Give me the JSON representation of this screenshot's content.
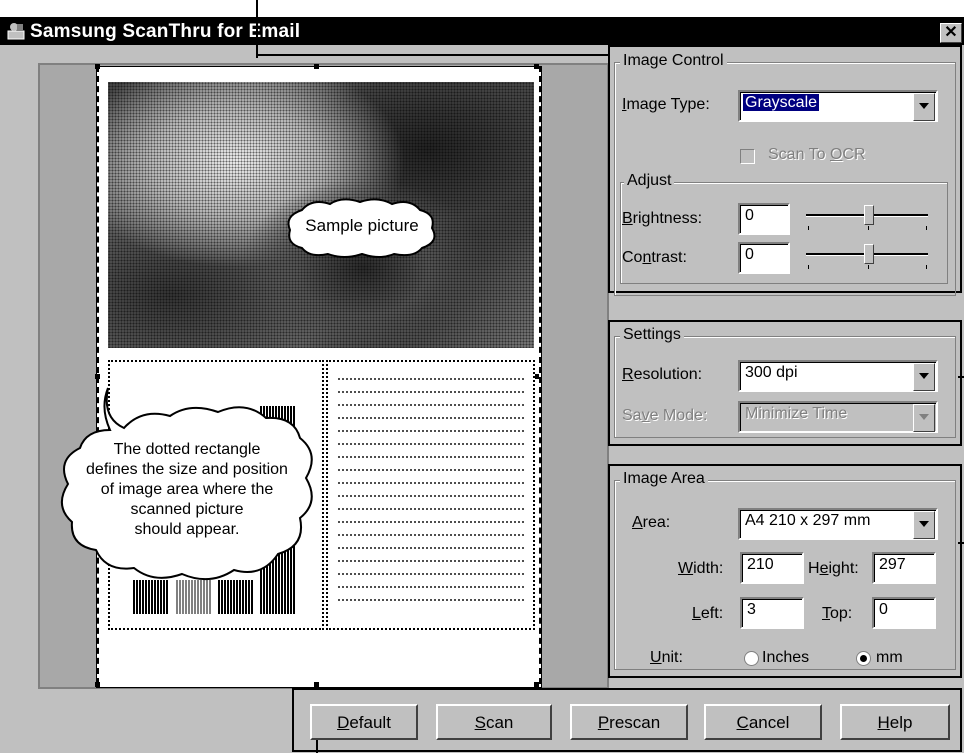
{
  "window": {
    "title": "Samsung ScanThru for Email",
    "close_glyph": "✕",
    "icon": "scanner-person-icon"
  },
  "preview": {
    "sample_picture_label": "Sample picture",
    "callout_text": [
      "The dotted rectangle",
      "defines the size and position",
      "of image area where the",
      "scanned picture",
      "should appear."
    ]
  },
  "image_control": {
    "legend": "Image Control",
    "image_type_label": "Image Type:",
    "image_type_value": "Grayscale",
    "scan_to_ocr_label": "Scan To OCR",
    "adjust_legend": "Adjust",
    "brightness_label": "Brightness:",
    "brightness_value": "0",
    "contrast_label": "Contrast:",
    "contrast_value": "0"
  },
  "settings": {
    "legend": "Settings",
    "resolution_label": "Resolution:",
    "resolution_value": "300 dpi",
    "save_mode_label": "Save Mode:",
    "save_mode_value": "Minimize Time"
  },
  "image_area": {
    "legend": "Image Area",
    "area_label": "Area:",
    "area_value": "A4 210 x 297 mm",
    "width_label": "Width:",
    "width_value": "210",
    "height_label": "Height:",
    "height_value": "297",
    "left_label": "Left:",
    "left_value": "3",
    "top_label": "Top:",
    "top_value": "0",
    "unit_label": "Unit:",
    "unit_inches": "Inches",
    "unit_mm": "mm",
    "unit_selected": "mm"
  },
  "buttons": {
    "default": "Default",
    "scan": "Scan",
    "prescan": "Prescan",
    "cancel": "Cancel",
    "help": "Help"
  }
}
